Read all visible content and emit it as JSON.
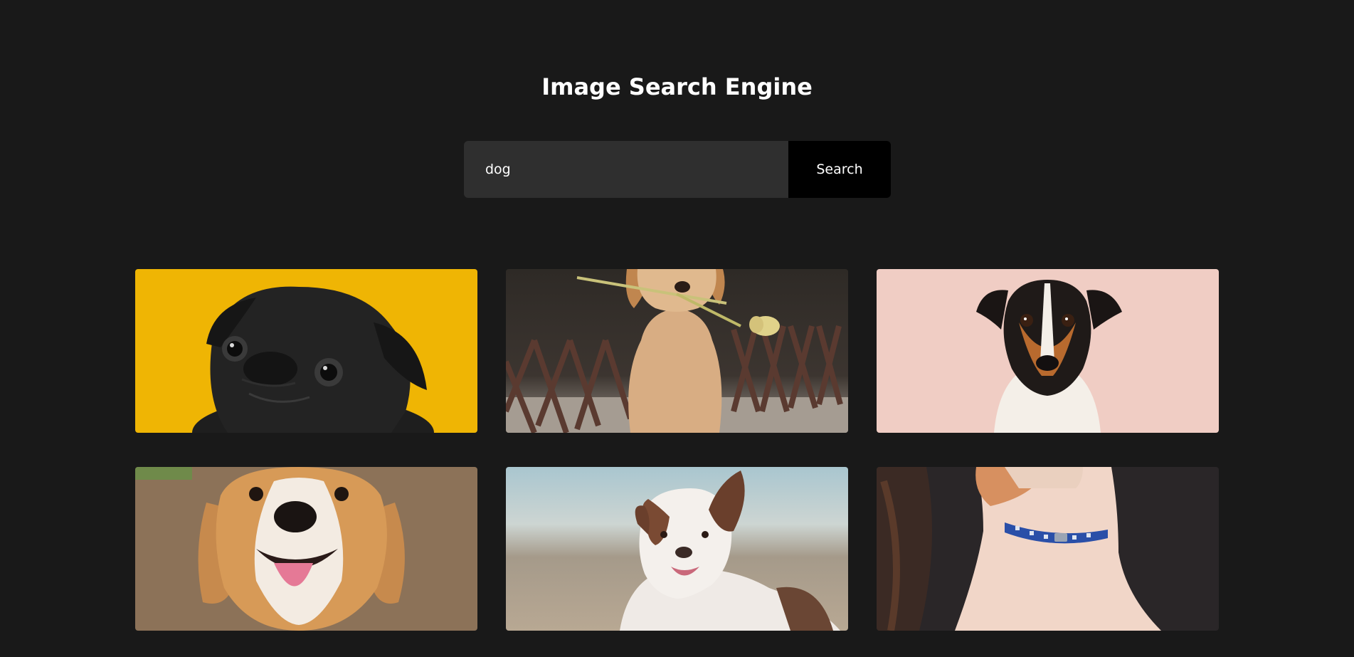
{
  "header": {
    "title": "Image Search Engine"
  },
  "search": {
    "value": "dog",
    "button_label": "Search"
  },
  "results": [
    {
      "subject": "black-pug",
      "background": "#efb504"
    },
    {
      "subject": "golden-retriever-with-tulip",
      "background": "#3a3430"
    },
    {
      "subject": "jack-russell-terrier",
      "background": "#f0cdc4"
    },
    {
      "subject": "beagle",
      "background": "#8c7258"
    },
    {
      "subject": "australian-shepherd",
      "background": "#b9c4c6"
    },
    {
      "subject": "dog-with-blue-collar",
      "background": "#2a2628"
    }
  ]
}
